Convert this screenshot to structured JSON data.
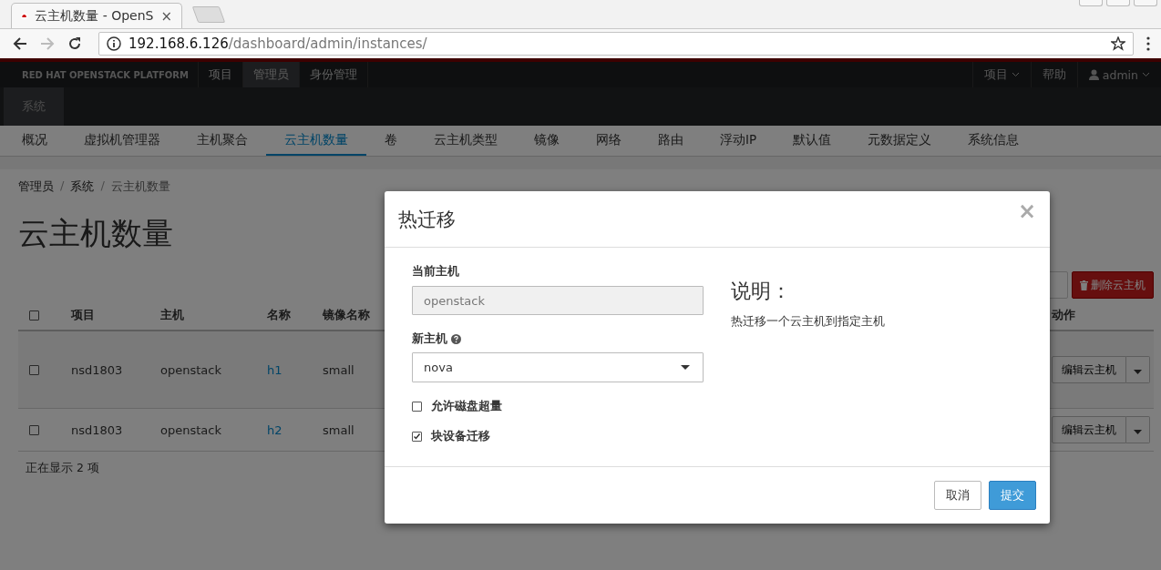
{
  "browser": {
    "tab": {
      "title": "云主机数量 - OpenS",
      "close": "×"
    },
    "url_host": "192.168.6.126",
    "url_path": "/dashboard/admin/instances/"
  },
  "navbar": {
    "brand": "RED HAT OPENSTACK PLATFORM",
    "items": [
      {
        "label": "项目",
        "selected": false
      },
      {
        "label": "管理员",
        "selected": true
      },
      {
        "label": "身份管理",
        "selected": false
      }
    ],
    "right": [
      {
        "label": "项目",
        "kind": "dropdown"
      },
      {
        "label": "帮助",
        "kind": "link"
      },
      {
        "label": "admin",
        "kind": "user"
      }
    ]
  },
  "system_bar": {
    "items": [
      {
        "label": "系统",
        "selected": true
      }
    ]
  },
  "subnav": [
    {
      "label": "概况",
      "selected": false
    },
    {
      "label": "虚拟机管理器",
      "selected": false
    },
    {
      "label": "主机聚合",
      "selected": false
    },
    {
      "label": "云主机数量",
      "selected": true
    },
    {
      "label": "卷",
      "selected": false
    },
    {
      "label": "云主机类型",
      "selected": false
    },
    {
      "label": "镜像",
      "selected": false
    },
    {
      "label": "网络",
      "selected": false
    },
    {
      "label": "路由",
      "selected": false
    },
    {
      "label": "浮动IP",
      "selected": false
    },
    {
      "label": "默认值",
      "selected": false
    },
    {
      "label": "元数据定义",
      "selected": false
    },
    {
      "label": "系统信息",
      "selected": false
    }
  ],
  "breadcrumb": [
    {
      "label": "管理员",
      "separator": "/"
    },
    {
      "label": "系统",
      "separator": "/"
    },
    {
      "label": "云主机数量"
    }
  ],
  "page_title": "云主机数量",
  "actions": {
    "delete_button": "删除云主机"
  },
  "table": {
    "select_all": {
      "checked": false
    },
    "columns": [
      "项目",
      "主机",
      "名称",
      "镜像名称",
      "动作"
    ],
    "rows": [
      {
        "checked": false,
        "project": "nsd1803",
        "host": "openstack",
        "name": "h1",
        "image": "small",
        "action": "编辑云主机"
      },
      {
        "checked": false,
        "project": "nsd1803",
        "host": "openstack",
        "name": "h2",
        "image": "small",
        "action": "编辑云主机"
      }
    ],
    "footer": "正在显示 2 项"
  },
  "modal": {
    "title": "热迁移",
    "close": "×",
    "current_host": {
      "label": "当前主机",
      "value": "openstack",
      "disabled": true
    },
    "new_host": {
      "label": "新主机",
      "value": "nova"
    },
    "options": [
      {
        "label": "允许磁盘超量",
        "checked": false
      },
      {
        "label": "块设备迁移",
        "checked": true
      }
    ],
    "help_title": "说明：",
    "help_text": "热迁移一个云主机到指定主机",
    "buttons": [
      {
        "label": "取消",
        "kind": "default"
      },
      {
        "label": "提交",
        "kind": "primary"
      }
    ]
  }
}
